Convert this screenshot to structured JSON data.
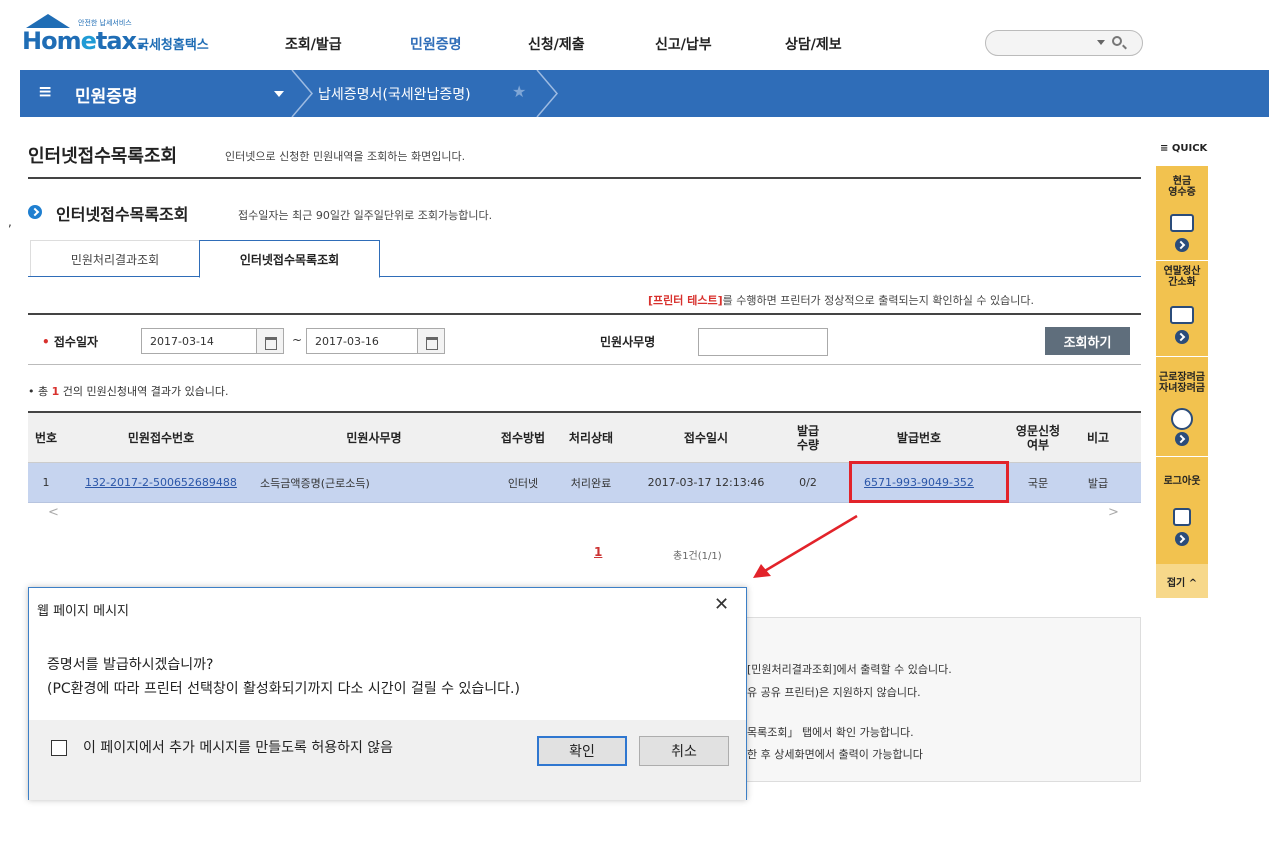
{
  "header": {
    "logo_small": "안전한 납세서비스",
    "logo_main_a": "Hom",
    "logo_main_e": "e",
    "logo_main_b": "tax.",
    "logo_sub": "국세청홈택스",
    "nav": [
      "조회/발급",
      "민원증명",
      "신청/제출",
      "신고/납부",
      "상담/제보"
    ]
  },
  "menubar": {
    "hamburger": "≡",
    "section": "민원증명",
    "current": "납세증명서(국세완납증명)",
    "star": "★"
  },
  "page": {
    "title": "인터넷접수목록조회",
    "desc": "인터넷으로 신청한 민원내역을 조회하는 화면입니다.",
    "section_title": "인터넷접수목록조회",
    "section_desc": "접수일자는 최근 90일간 일주일단위로 조회가능합니다.",
    "stray_tick": ","
  },
  "tabs": [
    {
      "label": "민원처리결과조회"
    },
    {
      "label": "인터넷접수목록조회"
    }
  ],
  "printer_note": {
    "highlight": "[프린터 테스트]",
    "rest": "를 수행하면 프린터가 정상적으로 출력되는지 확인하실 수 있습니다."
  },
  "search": {
    "required_mark": "•",
    "date_label": "접수일자",
    "date_from": "2017-03-14",
    "tilde": "~",
    "date_to": "2017-03-16",
    "name_label": "민원사무명",
    "name_value": "",
    "button": "조회하기"
  },
  "result": {
    "prefix": "• 총 ",
    "count": "1",
    "suffix": " 건의 민원신청내역 결과가 있습니다."
  },
  "table": {
    "headers": [
      "번호",
      "민원접수번호",
      "민원사무명",
      "접수방법",
      "처리상태",
      "접수일시",
      "발급\n수량",
      "발급번호",
      "영문신청\n여부",
      "비고"
    ],
    "rows": [
      [
        "1",
        "132-2017-2-500652689488",
        "소득금액증명(근로소득)",
        "인터넷",
        "처리완료",
        "2017-03-17 12:13:46",
        "0/2",
        "6571-993-9049-352",
        "국문",
        "발급"
      ]
    ],
    "scroll_left": "<",
    "scroll_right": ">"
  },
  "pager": {
    "page": "1",
    "total": "총1건(1/1)"
  },
  "info_lines": [
    "[민원처리결과조회]에서 출력할 수 있습니다.",
    "유 공유 프린터)은 지원하지 않습니다.",
    "목록조회」 탭에서 확인 가능합니다.",
    "한 후 상세화면에서 출력이 가능합니다"
  ],
  "quick": {
    "label": "≡ QUICK",
    "items": [
      "현금\n영수증",
      "연말정산\n간소화",
      "근로장려금\n자녀장려금",
      "로그아웃"
    ],
    "close": "접기 ^"
  },
  "dialog": {
    "title": "웹 페이지 메시지",
    "close": "✕",
    "msg1": "증명서를 발급하시겠습니까?",
    "msg2": "(PC환경에 따라 프린터 선택창이 활성화되기까지 다소 시간이 걸릴 수 있습니다.)",
    "checkbox_label": "이 페이지에서 추가 메시지를 만들도록 허용하지 않음",
    "ok": "확인",
    "cancel": "취소"
  },
  "colors": {
    "brand_blue": "#2f6db8",
    "highlight_red": "#e2232a",
    "quick_yellow": "#f2c24f",
    "row_selected": "#c6d4ef"
  }
}
